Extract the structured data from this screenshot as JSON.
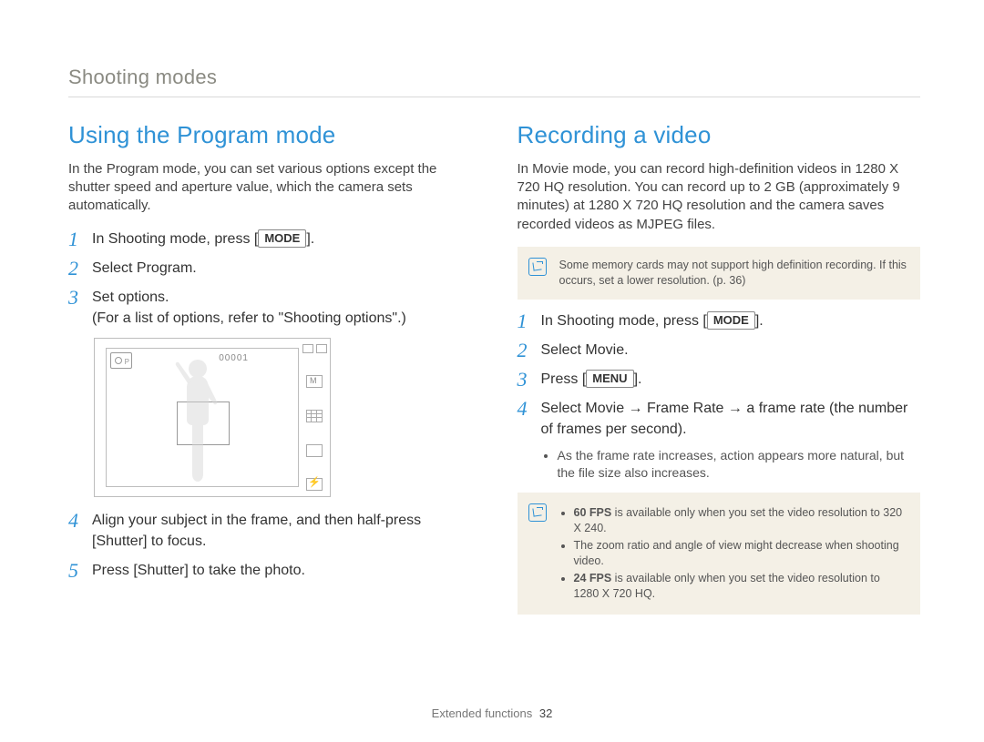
{
  "chapter": "Shooting modes",
  "footer": {
    "label": "Extended functions",
    "page": "32"
  },
  "left": {
    "title": "Using the Program mode",
    "intro": "In the Program mode, you can set various options except the shutter speed and aperture value, which the camera sets automatically.",
    "step1_pre": "In Shooting mode, press [",
    "step1_key": "MODE",
    "step1_post": "].",
    "step2": "Select Program.",
    "step3_line1": "Set options.",
    "step3_line2": "(For a list of options, refer to \"Shooting options\".)",
    "lcd_counter": "00001",
    "step4": "Align your subject in the frame, and then half-press [Shutter] to focus.",
    "step5": "Press [Shutter] to take the photo."
  },
  "right": {
    "title": "Recording a video",
    "intro": "In Movie mode, you can record high-definition videos in 1280 X 720 HQ resolution. You can record up to 2 GB (approximately 9 minutes) at 1280 X 720 HQ resolution and the camera saves recorded videos as MJPEG files.",
    "note1": "Some memory cards may not support high definition recording. If this occurs, set a lower resolution. (p. 36)",
    "step1_pre": "In Shooting mode, press [",
    "step1_key": "MODE",
    "step1_post": "].",
    "step2": "Select Movie.",
    "step3_pre": "Press [",
    "step3_key": "MENU",
    "step3_post": "].",
    "step4": "Select Movie → Frame Rate → a frame rate (the number of frames per second).",
    "step4_bullet": "As the frame rate increases, action appears more natural, but the file size also increases.",
    "note2": {
      "b1_strong": "60 FPS",
      "b1_rest": " is available only when you set the video resolution to 320 X 240.",
      "b2": "The zoom ratio and angle of view might decrease when shooting video.",
      "b3_strong": "24 FPS",
      "b3_rest": " is available only when you set the video resolution to 1280 X 720 HQ."
    }
  }
}
